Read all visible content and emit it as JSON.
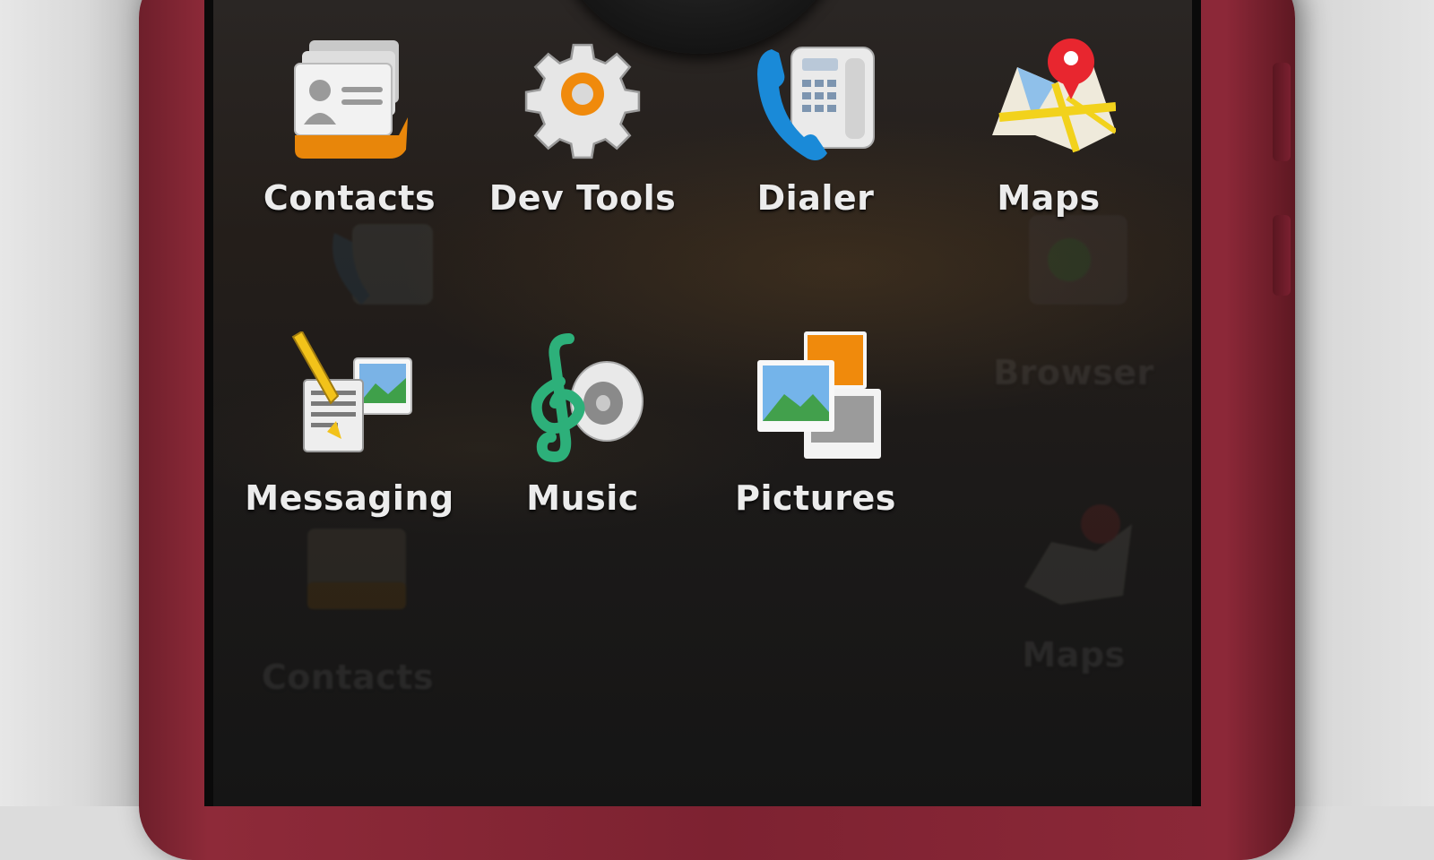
{
  "launcher": {
    "apps": [
      {
        "label": "Contacts",
        "icon": "contacts-icon"
      },
      {
        "label": "Dev Tools",
        "icon": "gear-icon"
      },
      {
        "label": "Dialer",
        "icon": "phone-icon"
      },
      {
        "label": "Maps",
        "icon": "map-icon"
      },
      {
        "label": "Messaging",
        "icon": "messaging-icon"
      },
      {
        "label": "Music",
        "icon": "music-icon"
      },
      {
        "label": "Pictures",
        "icon": "pictures-icon"
      }
    ],
    "ghost_apps": [
      {
        "label": "Browser",
        "icon": "globe-icon"
      },
      {
        "label": "Contacts",
        "icon": "contacts-icon"
      },
      {
        "label": "Maps",
        "icon": "map-icon"
      }
    ]
  },
  "colors": {
    "phone_body": "#7d2231",
    "screen_bg": "#1c1a19",
    "label_text": "#ececec"
  }
}
